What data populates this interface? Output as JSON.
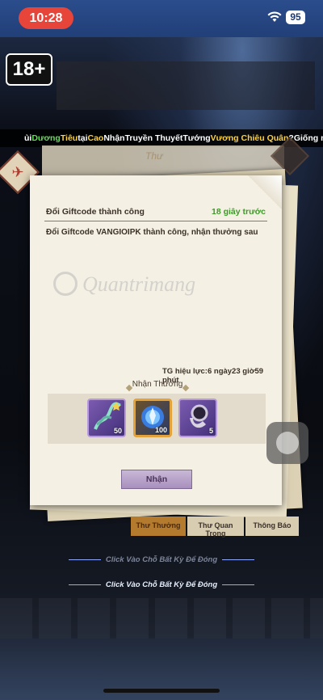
{
  "status_bar": {
    "time": "10:28",
    "battery": "95"
  },
  "age_rating": "18+",
  "ticker": [
    {
      "text": "ủi",
      "c": "w"
    },
    {
      "text": "Dương",
      "c": "g"
    },
    {
      "text": "Tiêu",
      "c": "y"
    },
    {
      "text": "tại",
      "c": "w"
    },
    {
      "text": "Cao",
      "c": "y"
    },
    {
      "text": "Nhận",
      "c": "w"
    },
    {
      "text": "Truyền Thuyết",
      "c": "w"
    },
    {
      "text": "Tướng",
      "c": "w"
    },
    {
      "text": "Vương Chiêu Quân",
      "c": "y"
    },
    {
      "text": "?Giống như Âu Hoàng phụ",
      "c": "w"
    }
  ],
  "mail_tab_label": "Thư",
  "message": {
    "title": "Đổi Giftcode thành công",
    "time": "18 giây trước",
    "body": "Đổi Giftcode VANGIOIPK thành công, nhận thưởng sau",
    "expiry": "TG hiệu lực:6 ngày23 giờ59 phút"
  },
  "rewards": {
    "title": "Nhận Thưởng",
    "items": [
      {
        "icon": "ribbon-item-icon",
        "count": "50"
      },
      {
        "icon": "blue-crystal-orb-icon",
        "count": "100"
      },
      {
        "icon": "silver-ring-icon",
        "count": "5"
      }
    ]
  },
  "claim_button": "Nhận",
  "watermark": "Quantrimang",
  "bottom_tabs": [
    "Thư Thưởng",
    "Thư Quan Trọng",
    "Thông Báo"
  ],
  "close_hint": "Click Vào Chỗ Bất Kỳ Để Đóng",
  "colors": {
    "accent_green": "#3f9a2a",
    "status_red": "#e7453a",
    "gold_frame": "#e3a33a"
  }
}
